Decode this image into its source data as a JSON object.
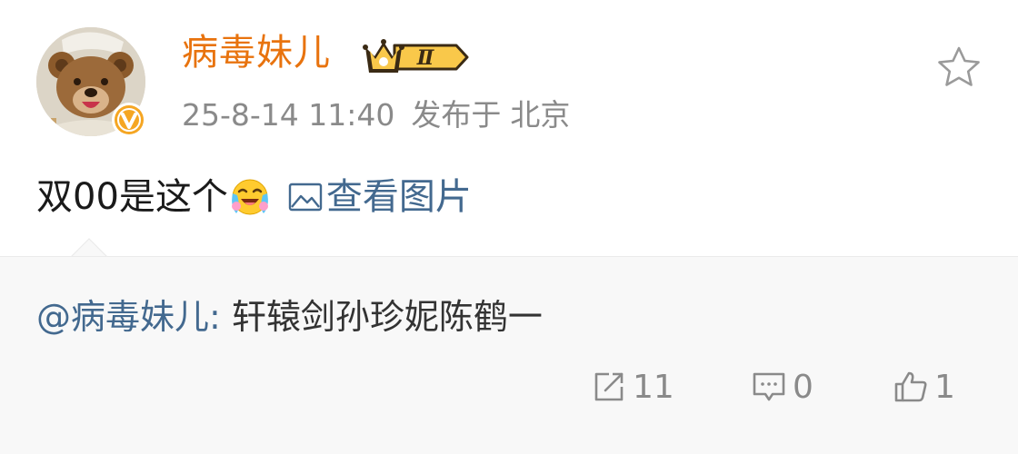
{
  "post": {
    "username": "病毒妹儿",
    "vip_level": "Ⅱ",
    "timestamp": "25-8-14 11:40",
    "location_prefix": "发布于",
    "location": "北京",
    "text": "双00是这个",
    "view_images_label": "查看图片",
    "icons": {
      "avatar": "bear-avatar",
      "verified": "orange-v-verified-icon",
      "favorite": "star-outline-icon",
      "emoji": "crying-laughing-emoji",
      "image": "picture-icon"
    }
  },
  "repost": {
    "mention": "@病毒妹儿:",
    "text": "轩辕剑孙珍妮陈鹤一",
    "share_count": "11",
    "comment_count": "0",
    "like_count": "1"
  },
  "colors": {
    "username": "#e8730e",
    "link": "#43698f",
    "meta": "#8a8a8a",
    "repost_bg": "#f8f8f8"
  }
}
